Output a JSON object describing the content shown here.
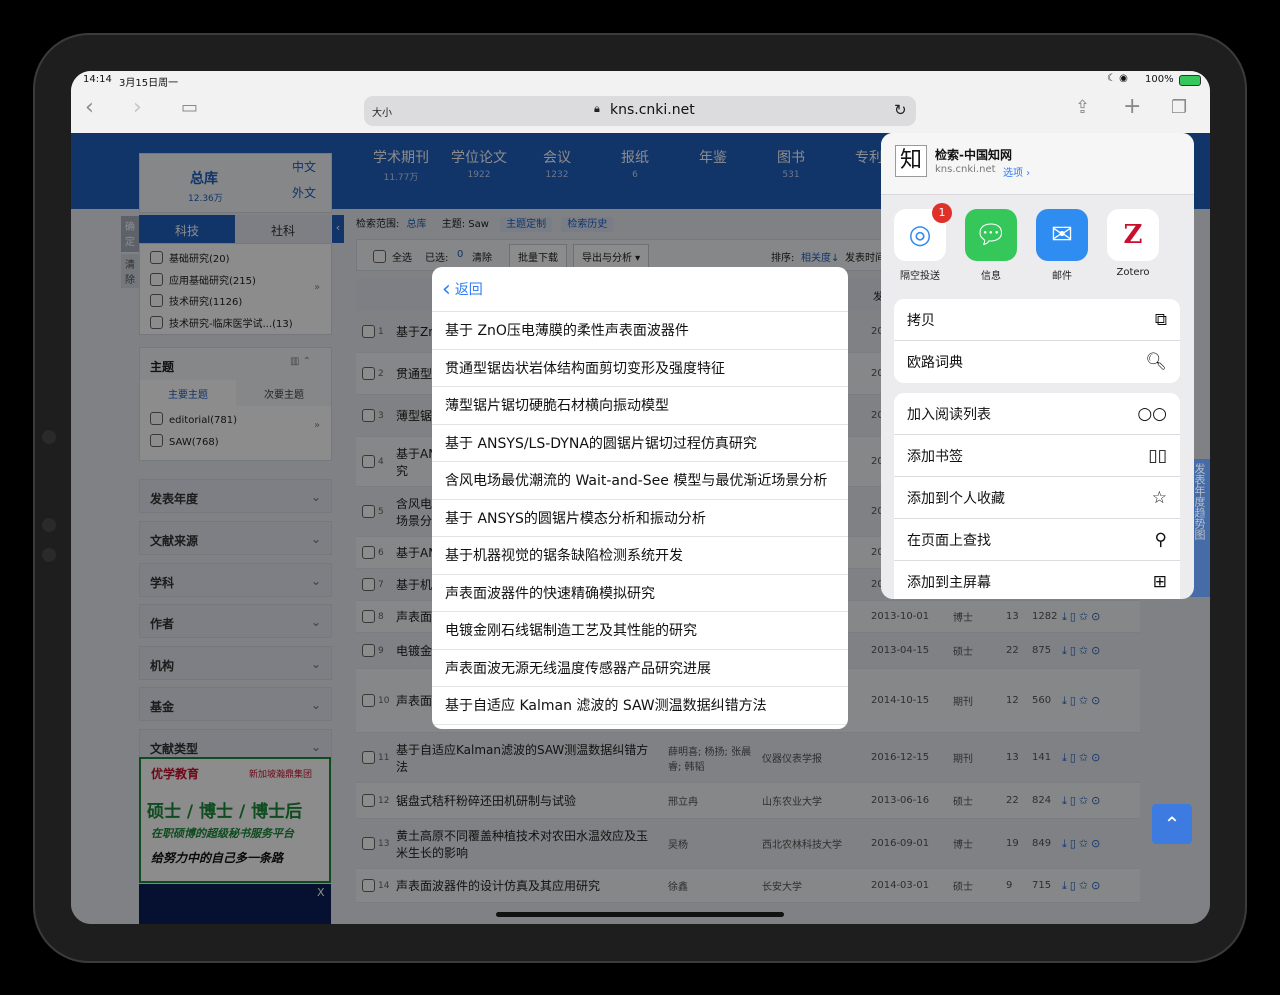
{
  "status": {
    "time": "14:14",
    "date": "3月15日周一",
    "battery": "100%"
  },
  "browser": {
    "text_size": "大小",
    "url": "kns.cnki.net"
  },
  "cnki": {
    "library": {
      "title": "总库",
      "count": "12.36万",
      "zh": "中文",
      "wai": "外文"
    },
    "tabs": [
      {
        "label": "学术期刊",
        "count": "11.77万"
      },
      {
        "label": "学位论文",
        "count": "1922"
      },
      {
        "label": "会议",
        "count": "1232"
      },
      {
        "label": "报纸",
        "count": "6"
      },
      {
        "label": "年鉴",
        "count": ""
      },
      {
        "label": "图书",
        "count": "531"
      },
      {
        "label": "专利",
        "count": ""
      }
    ],
    "side_left": {
      "confirm": "确定",
      "clear": "清除"
    },
    "sub_tabs": {
      "kj": "科技",
      "sk": "社科"
    },
    "categories": [
      "基础研究(20)",
      "应用基础研究(215)",
      "技术研究(1126)",
      "技术研究-临床医学试...(13)"
    ],
    "topic": {
      "title": "主题",
      "main": "主要主题",
      "secondary": "次要主题",
      "items": [
        "editorial(781)",
        "SAW(768)"
      ]
    },
    "facets": [
      "发表年度",
      "文献来源",
      "学科",
      "作者",
      "机构",
      "基金",
      "文献类型"
    ],
    "ad": {
      "brand": "优学教育",
      "brand2": "新加坡瀚鼎集团",
      "line1": "硕士 / 博士 / 博士后",
      "line2": "在职硕博的超级秘书服务平台",
      "line3": "给努力中的自己多一条路",
      "close": "X"
    },
    "search_scope": {
      "label": "检索范围:",
      "scope": "总库",
      "subject": "主题: Saw",
      "custom": "主题定制",
      "history": "检索历史"
    },
    "listbar": {
      "select_all": "全选",
      "selected_label": "已选:",
      "selected": "0",
      "clear": "清除",
      "batch": "批量下载",
      "export": "导出与分析 ▾",
      "sort_label": "排序:",
      "sort_relevance": "相关度↓",
      "sort_date": "发表时间",
      "year_hint": "发"
    },
    "results": [
      {
        "n": "1",
        "title": "基于Zn",
        "date": "20",
        "src": "",
        "author": "",
        "type": "",
        "cite": "",
        "dl": ""
      },
      {
        "n": "2",
        "title": "贯通型",
        "date": "20",
        "src": "",
        "author": "",
        "type": "",
        "cite": "",
        "dl": ""
      },
      {
        "n": "3",
        "title": "薄型锯",
        "date": "201",
        "src": "",
        "author": "",
        "type": "",
        "cite": "",
        "dl": ""
      },
      {
        "n": "4",
        "title": "基于AN\n究",
        "date": "20",
        "src": "",
        "author": "",
        "type": "",
        "cite": "",
        "dl": ""
      },
      {
        "n": "5",
        "title": "含风电\n场景分",
        "date": "20",
        "src": "",
        "author": "",
        "type": "",
        "cite": "",
        "dl": ""
      },
      {
        "n": "6",
        "title": "基于AN",
        "date": "20",
        "src": "",
        "author": "",
        "type": "",
        "cite": "",
        "dl": ""
      },
      {
        "n": "7",
        "title": "基于机",
        "date": "20",
        "src": "",
        "author": "",
        "type": "",
        "cite": "",
        "dl": ""
      },
      {
        "n": "8",
        "title": "声表面",
        "date": "2013-10-01",
        "src": "",
        "author": "",
        "type": "博士",
        "cite": "13",
        "dl": "1282"
      },
      {
        "n": "9",
        "title": "电镀金",
        "date": "2013-04-15",
        "src": "",
        "author": "",
        "type": "硕士",
        "cite": "22",
        "dl": "875"
      },
      {
        "n": "10",
        "title": "声表面",
        "date": "2014-10-15",
        "src": "",
        "author": "",
        "type": "期刊",
        "cite": "12",
        "dl": "560"
      },
      {
        "n": "11",
        "title": "基于自适应Kalman滤波的SAW测温数据纠错方法",
        "date": "2016-12-15",
        "src": "仪器仪表学报",
        "author": "薛明喜; 杨扬; 张晨睿; 韩韬",
        "type": "期刊",
        "cite": "13",
        "dl": "141"
      },
      {
        "n": "12",
        "title": "锯盘式秸秆粉碎还田机研制与试验",
        "date": "2013-06-16",
        "src": "山东农业大学",
        "author": "邢立冉",
        "type": "硕士",
        "cite": "22",
        "dl": "824"
      },
      {
        "n": "13",
        "title": "黄土高原不同覆盖种植技术对农田水温效应及玉米生长的影响",
        "date": "2016-09-01",
        "src": "西北农林科技大学",
        "author": "吴杨",
        "type": "博士",
        "cite": "19",
        "dl": "849"
      },
      {
        "n": "14",
        "title": "声表面波器件的设计仿真及其应用研究",
        "date": "2014-03-01",
        "src": "长安大学",
        "author": "徐鑫",
        "type": "硕士",
        "cite": "9",
        "dl": "715"
      }
    ],
    "side_float": "发表年度趋势图"
  },
  "popup": {
    "back": "返回",
    "items": [
      "基于 ZnO压电薄膜的柔性声表面波器件",
      "贯通型锯齿状岩体结构面剪切变形及强度特征",
      "薄型锯片锯切硬脆石材横向振动模型",
      "基于 ANSYS/LS-DYNA的圆锯片锯切过程仿真研究",
      "含风电场最优潮流的 Wait-and-See 模型与最优渐近场景分析",
      "基于 ANSYS的圆锯片模态分析和振动分析",
      "基于机器视觉的锯条缺陷检测系统开发",
      "声表面波器件的快速精确模拟研究",
      "电镀金刚石线锯制造工艺及其性能的研究",
      "声表面波无源无线温度传感器产品研究进展",
      "基于自适应 Kalman 滤波的 SAW测温数据纠错方法"
    ]
  },
  "share": {
    "title": "检索-中国知网",
    "site": "kns.cnki.net",
    "options": "选项 ›",
    "badge": "1",
    "apps": [
      {
        "name": "隔空投送",
        "color": "#ffffff"
      },
      {
        "name": "信息",
        "color": "#35c759"
      },
      {
        "name": "邮件",
        "color": "#2f8cf0"
      },
      {
        "name": "Zotero",
        "color": "#ffffff"
      }
    ],
    "group1": [
      {
        "label": "拷贝",
        "icon": "copy-icon"
      },
      {
        "label": "欧路词典",
        "icon": "dictionary-icon"
      }
    ],
    "group2": [
      {
        "label": "加入阅读列表",
        "icon": "glasses-icon"
      },
      {
        "label": "添加书签",
        "icon": "book-icon"
      },
      {
        "label": "添加到个人收藏",
        "icon": "star-icon"
      },
      {
        "label": "在页面上查找",
        "icon": "search-icon"
      },
      {
        "label": "添加到主屏幕",
        "icon": "add-square-icon"
      }
    ]
  }
}
